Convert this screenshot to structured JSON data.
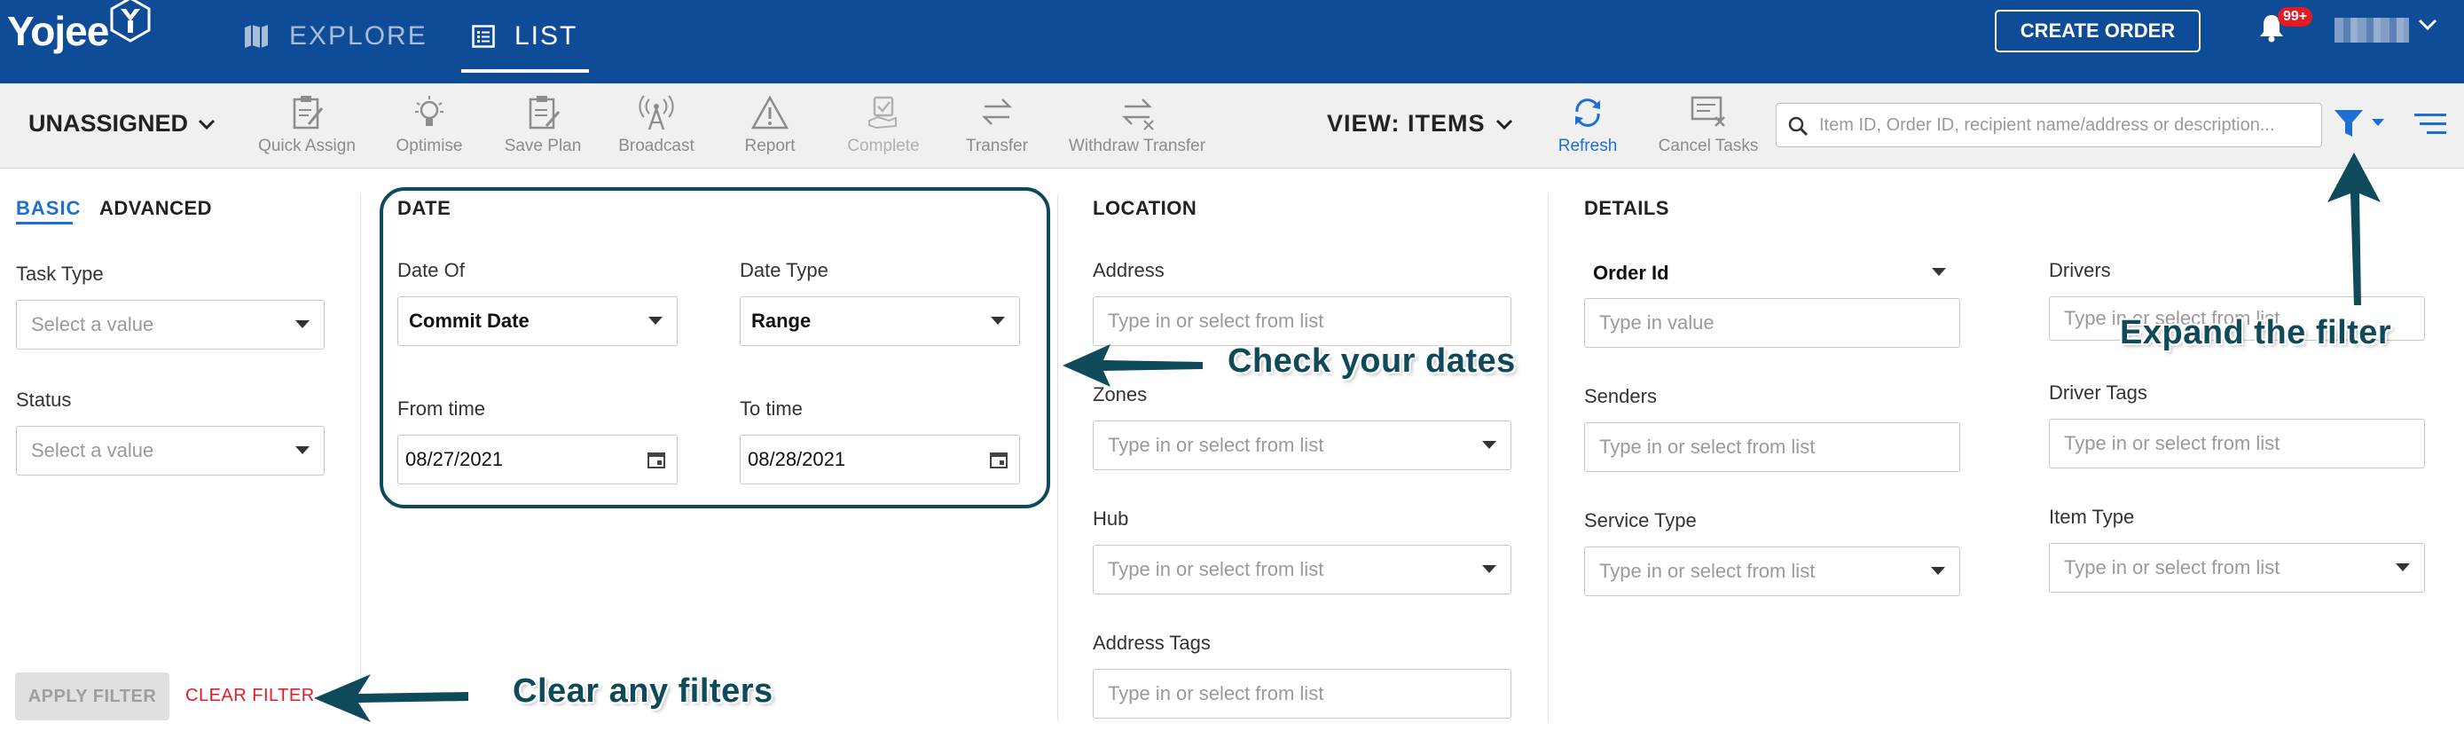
{
  "app": {
    "brand": "Yojee",
    "nav": [
      {
        "id": "explore",
        "label": "EXPLORE"
      },
      {
        "id": "list",
        "label": "LIST"
      }
    ],
    "create_order_label": "CREATE ORDER",
    "notification_badge": "99+"
  },
  "toolbar": {
    "assignment_view": "UNASSIGNED",
    "tools": [
      {
        "label": "Quick Assign",
        "icon": "clipboard-edit-icon"
      },
      {
        "label": "Optimise",
        "icon": "lightbulb-icon"
      },
      {
        "label": "Save Plan",
        "icon": "clipboard-save-icon"
      },
      {
        "label": "Broadcast",
        "icon": "antenna-icon"
      },
      {
        "label": "Report",
        "icon": "warning-triangle-icon"
      },
      {
        "label": "Complete",
        "icon": "hand-check-icon"
      },
      {
        "label": "Transfer",
        "icon": "transfer-arrows-icon"
      },
      {
        "label": "Withdraw Transfer",
        "icon": "withdraw-transfer-icon"
      }
    ],
    "view_label": "VIEW: ITEMS",
    "refresh_label": "Refresh",
    "cancel_tasks_label": "Cancel Tasks",
    "search_placeholder": "Item ID, Order ID, recipient name/address or description..."
  },
  "filter": {
    "tabs": {
      "basic": "BASIC",
      "advanced": "ADVANCED"
    },
    "basic": {
      "task_type_label": "Task Type",
      "task_type_placeholder": "Select a value",
      "status_label": "Status",
      "status_placeholder": "Select a value"
    },
    "date": {
      "title": "DATE",
      "date_of_label": "Date Of",
      "date_of_value": "Commit Date",
      "date_type_label": "Date Type",
      "date_type_value": "Range",
      "from_label": "From time",
      "from_value": "08/27/2021",
      "to_label": "To time",
      "to_value": "08/28/2021"
    },
    "location": {
      "title": "LOCATION",
      "address_label": "Address",
      "zones_label": "Zones",
      "hub_label": "Hub",
      "address_tags_label": "Address Tags",
      "list_placeholder": "Type in or select from list"
    },
    "details": {
      "title": "DETAILS",
      "order_id_label": "Order Id",
      "order_id_placeholder": "Type in value",
      "senders_label": "Senders",
      "service_type_label": "Service Type",
      "drivers_label": "Drivers",
      "driver_tags_label": "Driver Tags",
      "item_type_label": "Item Type",
      "list_placeholder": "Type in or select from list"
    },
    "apply_label": "APPLY FILTER",
    "clear_label": "CLEAR FILTER"
  },
  "annotations": {
    "check_dates": "Check your dates",
    "expand_filter": "Expand the filter",
    "clear_filters": "Clear any filters"
  },
  "colors": {
    "brand_blue": "#0f4c97",
    "accent_blue": "#1d6fd1",
    "annotation": "#0e4a5a",
    "danger": "#e41b23"
  }
}
